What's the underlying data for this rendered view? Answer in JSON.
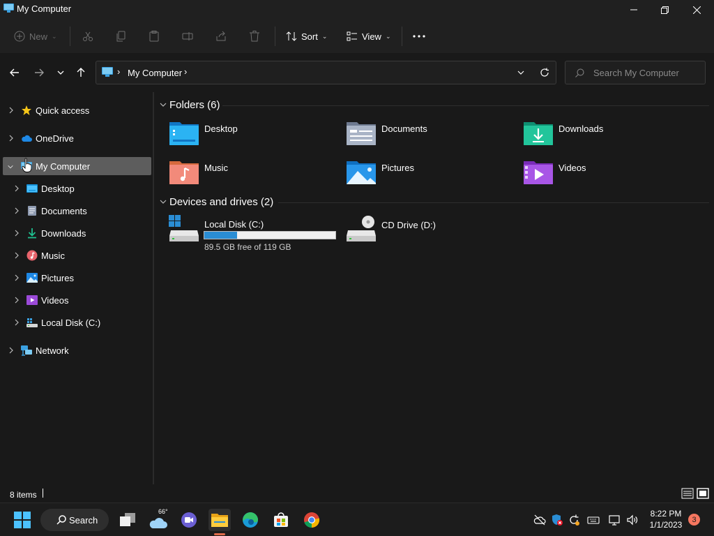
{
  "window": {
    "title": "My Computer"
  },
  "toolbar": {
    "new_label": "New",
    "sort_label": "Sort",
    "view_label": "View"
  },
  "address": {
    "location": "My Computer"
  },
  "search": {
    "placeholder": "Search My Computer"
  },
  "sidebar": {
    "items": [
      {
        "label": "Quick access",
        "icon": "star-icon"
      },
      {
        "label": "OneDrive",
        "icon": "cloud-icon"
      },
      {
        "label": "My Computer",
        "icon": "monitor-icon",
        "selected": true
      },
      {
        "label": "Desktop",
        "icon": "desktop-folder-icon"
      },
      {
        "label": "Documents",
        "icon": "documents-icon"
      },
      {
        "label": "Downloads",
        "icon": "download-icon"
      },
      {
        "label": "Music",
        "icon": "music-icon"
      },
      {
        "label": "Pictures",
        "icon": "pictures-icon"
      },
      {
        "label": "Videos",
        "icon": "videos-icon"
      },
      {
        "label": "Local Disk (C:)",
        "icon": "drive-icon"
      },
      {
        "label": "Network",
        "icon": "network-icon"
      }
    ]
  },
  "main": {
    "folders_header": "Folders (6)",
    "folders": [
      {
        "label": "Desktop",
        "icon": "desktop-folder-icon"
      },
      {
        "label": "Documents",
        "icon": "documents-folder-icon"
      },
      {
        "label": "Downloads",
        "icon": "downloads-folder-icon"
      },
      {
        "label": "Music",
        "icon": "music-folder-icon"
      },
      {
        "label": "Pictures",
        "icon": "pictures-folder-icon"
      },
      {
        "label": "Videos",
        "icon": "videos-folder-icon"
      }
    ],
    "devices_header": "Devices and drives (2)",
    "drives": [
      {
        "label": "Local Disk (C:)",
        "free_text": "89.5 GB free of 119 GB",
        "used_fraction": 0.248,
        "icon": "hard-drive-icon"
      },
      {
        "label": "CD Drive (D:)",
        "icon": "cd-drive-icon"
      }
    ]
  },
  "status": {
    "items_text": "8 items"
  },
  "taskbar": {
    "search_label": "Search",
    "weather_temp": "66°",
    "time": "8:22 PM",
    "date": "1/1/2023",
    "notification_count": "3"
  },
  "colors": {
    "background": "#191919",
    "chrome": "#202020",
    "selected": "#5d5d5d",
    "drive_fill": "#2a8dd4",
    "accent_badge": "#f5765f"
  }
}
